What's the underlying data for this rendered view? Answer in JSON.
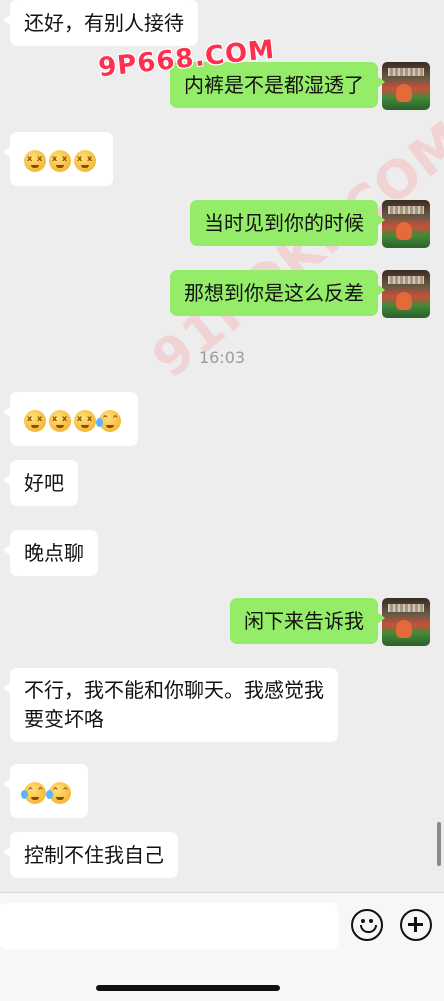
{
  "messages": [
    {
      "side": "left",
      "text": "还好，有别人接待"
    },
    {
      "side": "right",
      "text": "内裤是不是都湿透了"
    },
    {
      "side": "left",
      "emojis": [
        "dizzy-face",
        "dizzy-face",
        "dizzy-face"
      ]
    },
    {
      "side": "right",
      "text": "当时见到你的时候"
    },
    {
      "side": "right",
      "text": "那想到你是这么反差"
    },
    {
      "side": "left",
      "emojis": [
        "dizzy-face",
        "dizzy-face",
        "dizzy-face",
        "laughing-tears"
      ]
    },
    {
      "side": "left",
      "text": "好吧"
    },
    {
      "side": "left",
      "text": "晚点聊"
    },
    {
      "side": "right",
      "text": "闲下来告诉我"
    },
    {
      "side": "left",
      "text": "不行，我不能和你聊天。我感觉我",
      "text2": "要变坏咯"
    },
    {
      "side": "left",
      "emojis": [
        "laughing-tears",
        "laughing-tears"
      ]
    },
    {
      "side": "left",
      "text": "控制不住我自己"
    }
  ],
  "timestamp": "16:03",
  "watermarks": [
    "9P668.COM",
    "91POKI.COM"
  ],
  "input": {
    "placeholder": "",
    "icons": [
      "emoji-icon",
      "plus-icon"
    ]
  },
  "colors": {
    "sent_bubble": "#95ec69",
    "received_bubble": "#ffffff",
    "background": "#ededed"
  }
}
